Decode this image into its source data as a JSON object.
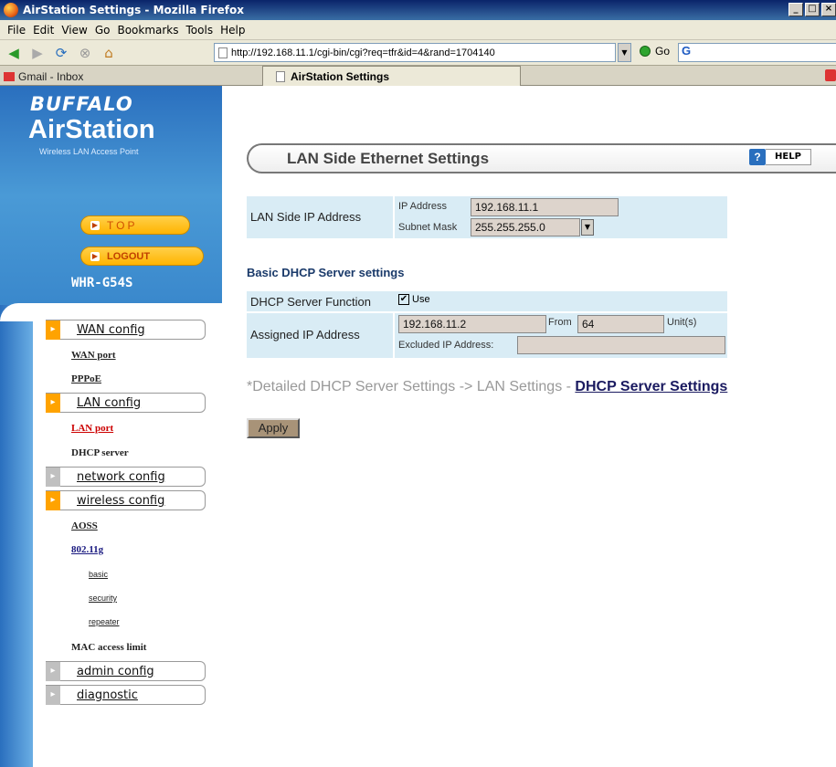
{
  "window": {
    "title": "AirStation Settings - Mozilla Firefox"
  },
  "menu": [
    "File",
    "Edit",
    "View",
    "Go",
    "Bookmarks",
    "Tools",
    "Help"
  ],
  "nav": {
    "url": "http://192.168.11.1/cgi-bin/cgi?req=tfr&id=4&rand=1704140",
    "go_label": "Go",
    "search_glyph": "G"
  },
  "tabs": [
    {
      "label": "Gmail - Inbox"
    },
    {
      "label": "AirStation Settings"
    }
  ],
  "sidebar": {
    "brand": "BUFFALO",
    "product": "AirStation",
    "subtitle": "Wireless LAN Access Point",
    "top_label": "TOP",
    "logout_label": "LOGOUT",
    "model": "WHR-G54S",
    "wan_config": "WAN config",
    "wan_port": "WAN port",
    "pppoe": "PPPoE",
    "lan_config": "LAN config",
    "lan_port": "LAN port",
    "dhcp_server": "DHCP server",
    "network_config": "network config",
    "wireless_config": "wireless config",
    "aoss": "AOSS",
    "w80211g": "802.11g",
    "basic": "basic",
    "security": "security",
    "repeater": "repeater",
    "mac_access_limit": "MAC access limit",
    "admin_config": "admin config",
    "diagnostic": "diagnostic"
  },
  "main": {
    "header": "LAN Side Ethernet Settings",
    "help_label": "HELP",
    "lan_ip": {
      "label": "LAN Side IP Address",
      "ip_label": "IP Address",
      "ip_value": "192.168.11.1",
      "mask_label": "Subnet Mask",
      "mask_value": "255.255.255.0"
    },
    "dhcp_title": "Basic DHCP Server settings",
    "dhcp_function_label": "DHCP Server Function",
    "dhcp_use_label": "Use",
    "assigned_label": "Assigned IP Address",
    "assigned_ip": "192.168.11.2",
    "from_label": "From",
    "from_value": "64",
    "units_label": "Unit(s)",
    "excluded_label": "Excluded IP Address:",
    "excluded_value": "",
    "detail_prefix": "*Detailed DHCP Server Settings -> LAN Settings - ",
    "detail_link": "DHCP Server Settings",
    "apply_label": "Apply"
  }
}
